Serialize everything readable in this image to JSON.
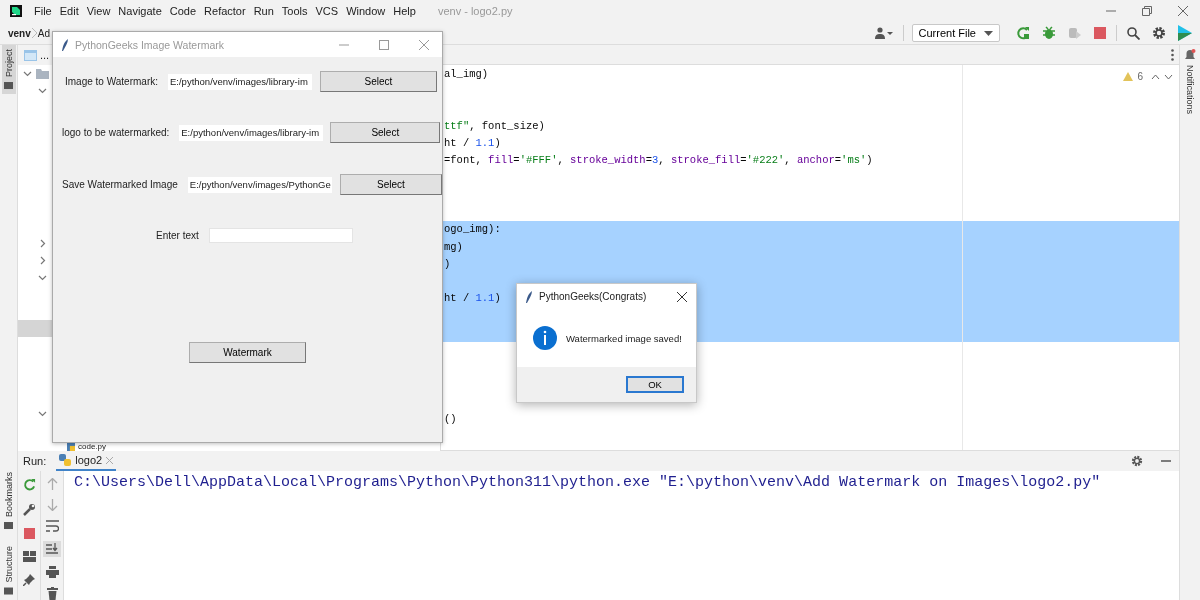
{
  "ide": {
    "menu": [
      "File",
      "Edit",
      "View",
      "Navigate",
      "Code",
      "Refactor",
      "Run",
      "Tools",
      "VCS",
      "Window",
      "Help"
    ],
    "title": "venv - logo2.py",
    "breadcrumb": [
      "venv",
      "Ad"
    ],
    "run_config": "Current File",
    "left_tabs": [
      {
        "label": "Project",
        "selected": true
      },
      {
        "label": "Bookmarks",
        "selected": false
      },
      {
        "label": "Structure",
        "selected": false
      }
    ],
    "right_tab": "Notifications"
  },
  "project_panel": {
    "tab_label": "...",
    "tree": {
      "kind": "folder",
      "expanded": true,
      "selected": false,
      "children": [
        {
          "kind": "folder",
          "expanded": true,
          "selected": false
        },
        {
          "kind": "folder",
          "expanded": false,
          "selected": false
        },
        {
          "kind": "folder",
          "expanded": false,
          "selected": false
        },
        {
          "kind": "folder",
          "expanded": true,
          "selected": false
        },
        {
          "kind": "file",
          "selected": true
        },
        {
          "kind": "folder",
          "expanded": true,
          "selected": false
        },
        {
          "kind": "file",
          "label": "code.py",
          "selected": false
        }
      ]
    }
  },
  "editor": {
    "problems": "6",
    "lines": [
      {
        "selected": false,
        "tokens": [
          {
            "kind": "plain",
            "text": "al_img)"
          }
        ]
      },
      {
        "selected": false
      },
      {
        "selected": false
      },
      {
        "selected": false,
        "tokens": [
          {
            "kind": "string",
            "text": "ttf\""
          },
          {
            "kind": "plain",
            "text": ", font_size)"
          }
        ]
      },
      {
        "selected": false,
        "tokens": [
          {
            "kind": "plain",
            "text": "ht / "
          },
          {
            "kind": "number",
            "text": "1.1"
          },
          {
            "kind": "plain",
            "text": ")"
          }
        ]
      },
      {
        "selected": false,
        "tokens": [
          {
            "kind": "plain",
            "text": "=font, "
          },
          {
            "kind": "param",
            "text": "fill"
          },
          {
            "kind": "plain",
            "text": "="
          },
          {
            "kind": "string",
            "text": "'#FFF'"
          },
          {
            "kind": "plain",
            "text": ", "
          },
          {
            "kind": "param",
            "text": "stroke_width"
          },
          {
            "kind": "plain",
            "text": "="
          },
          {
            "kind": "number",
            "text": "3"
          },
          {
            "kind": "plain",
            "text": ", "
          },
          {
            "kind": "param",
            "text": "stroke_fill"
          },
          {
            "kind": "plain",
            "text": "="
          },
          {
            "kind": "string",
            "text": "'#222'"
          },
          {
            "kind": "plain",
            "text": ", "
          },
          {
            "kind": "param",
            "text": "anchor"
          },
          {
            "kind": "plain",
            "text": "="
          },
          {
            "kind": "string",
            "text": "'ms'"
          },
          {
            "kind": "plain",
            "text": ")"
          }
        ]
      },
      {
        "selected": false
      },
      {
        "selected": false
      },
      {
        "selected": false
      },
      {
        "selected": true,
        "tokens": [
          {
            "kind": "plain",
            "text": "ogo_img):"
          }
        ]
      },
      {
        "selected": true,
        "tokens": [
          {
            "kind": "plain",
            "text": "mg)"
          }
        ]
      },
      {
        "selected": true,
        "tokens": [
          {
            "kind": "plain",
            "text": ")"
          }
        ]
      },
      {
        "selected": true
      },
      {
        "selected": true,
        "tokens": [
          {
            "kind": "plain",
            "text": "ht / "
          },
          {
            "kind": "number",
            "text": "1.1"
          },
          {
            "kind": "plain",
            "text": ")"
          }
        ]
      },
      {
        "selected": true
      },
      {
        "selected": true
      },
      {
        "selected": false
      },
      {
        "selected": false
      },
      {
        "selected": false
      },
      {
        "selected": false
      },
      {
        "selected": false,
        "tokens": [
          {
            "kind": "plain",
            "text": "()"
          }
        ]
      }
    ]
  },
  "run_panel": {
    "label": "Run:",
    "tab": "logo2",
    "output": "C:\\Users\\Dell\\AppData\\Local\\Programs\\Python\\Python311\\python.exe \"E:\\python\\venv\\Add Watermark on Images\\logo2.py\""
  },
  "app_window": {
    "title": "PythonGeeks Image Watermark",
    "rows": [
      {
        "label": "Image to Watermark:",
        "value": "E:/python/venv/images/library-im",
        "button": "Select"
      },
      {
        "label": "logo to be watermarked:",
        "value": "E:/python/venv/images/library-im",
        "button": "Select"
      },
      {
        "label": "Save Watermarked Image",
        "value": "E:/python/venv/images/PythonGe",
        "button": "Select"
      }
    ],
    "text_label": "Enter text",
    "action": "Watermark"
  },
  "dialog": {
    "title": "PythonGeeks(Congrats)",
    "message": "Watermarked image saved!",
    "button": "OK"
  }
}
